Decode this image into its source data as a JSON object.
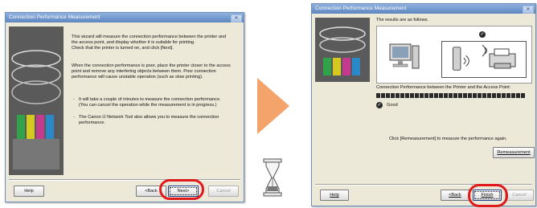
{
  "left_window": {
    "title": "Connection Performance Measurement",
    "close_glyph": "✕",
    "para1_lines": [
      "This wizard will measure the connection performance between the printer and",
      "the access point, and display whether it is suitable for printing.",
      "Check that the printer is turned on, and click [Next]."
    ],
    "para2_lines": [
      "When the connection performance is poor, place the printer closer to the access",
      "point and remove any interfering objects between them. Poor connection",
      "performance will cause unstable operation (such as slow printing)."
    ],
    "bullet1_lines": [
      "It will take a couple of minutes to measure the connection performance.",
      "(You can cancel the operation while the measurement is in progress.)"
    ],
    "bullet2_lines": [
      "The Canon IJ Network Tool also allows you to measure the connection",
      "performance."
    ],
    "buttons": {
      "help": "Help",
      "back": "<Back",
      "next": "Next>",
      "cancel": "Cancel"
    }
  },
  "right_window": {
    "title": "Connection Performance Measurement",
    "close_glyph": "✕",
    "results_label": "The results are as follows.",
    "connection_label": "Connection Performance between the Printer and the Access Point:",
    "status": "Good",
    "meter_level": 1.0,
    "remeasure_hint": "Click [Remeasurement] to measure the performance again.",
    "buttons": {
      "remeasurement": "Remeasurement",
      "help": "Help",
      "back": "<Back",
      "finish": "Finish",
      "cancel": "Cancel"
    }
  },
  "colors": {
    "highlight_ring": "#e01a1a",
    "arrow": "#f4a36b",
    "titlebar": "#6b90c8"
  },
  "icons": [
    "computer-icon",
    "access-point-icon",
    "printer-icon",
    "check-icon",
    "hourglass-icon",
    "arrow-right-icon"
  ]
}
